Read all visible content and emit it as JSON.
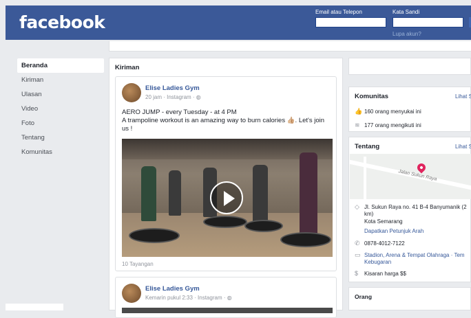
{
  "header": {
    "logo": "facebook",
    "email_label": "Email atau Telepon",
    "password_label": "Kata Sandi",
    "forgot_link": "Lupa akun?"
  },
  "sidebar": {
    "items": [
      {
        "label": "Beranda",
        "active": true
      },
      {
        "label": "Kiriman"
      },
      {
        "label": "Ulasan"
      },
      {
        "label": "Video"
      },
      {
        "label": "Foto"
      },
      {
        "label": "Tentang"
      },
      {
        "label": "Komunitas"
      }
    ]
  },
  "feed": {
    "title": "Kiriman",
    "posts": [
      {
        "page": "Elise Ladies Gym",
        "meta": "20 jam · Instagram · ◍",
        "text": "AERO JUMP - every Tuesday - at 4 PM\nA trampoline workout is an amazing way to burn calories 👍🏼. Let's join us !",
        "views": "10 Tayangan"
      },
      {
        "page": "Elise Ladies Gym",
        "meta": "Kemarin pukul 2:33 · Instagram · ◍"
      }
    ]
  },
  "community": {
    "title": "Komunitas",
    "link": "Lihat S",
    "likes": "160 orang menyukai ini",
    "follows": "177 orang mengikuti ini"
  },
  "about": {
    "title": "Tentang",
    "link": "Lihat S",
    "map_road": "Jalan Sukun Raya",
    "address": "Jl. Sukun Raya no. 41 B-4 Banyumanik (2",
    "address2": "km)",
    "city": "Kota Semarang",
    "directions": "Dapatkan Petunjuk Arah",
    "phone": "0878-4012-7122",
    "category": "Stadion, Arena & Tempat Olahraga · Tem",
    "category2": "Kebugaran",
    "price": "Kisaran harga $$"
  },
  "people": {
    "title": "Orang"
  }
}
